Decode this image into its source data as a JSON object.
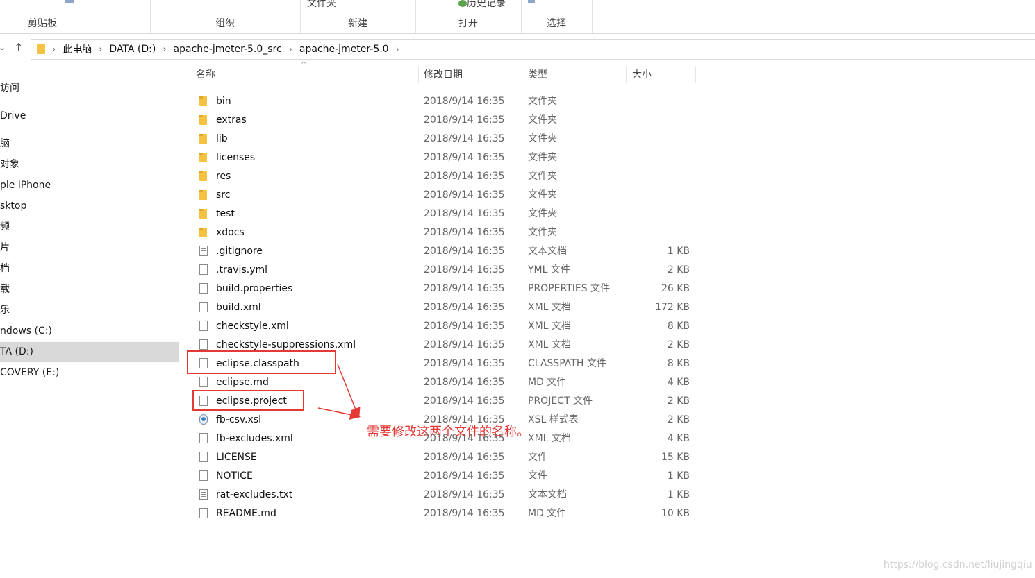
{
  "ribbon": {
    "groups": [
      "剪贴板",
      "组织",
      "新建",
      "打开",
      "选择"
    ],
    "top_new_folder": "文件夹",
    "top_history": "历史记录"
  },
  "address": {
    "crumbs": [
      "此电脑",
      "DATA (D:)",
      "apache-jmeter-5.0_src",
      "apache-jmeter-5.0"
    ]
  },
  "nav": {
    "items": [
      "访问",
      "Drive",
      "脑",
      "对象",
      "ple iPhone",
      "sktop",
      "频",
      "片",
      "档",
      "载",
      "乐",
      "ndows (C:)",
      "TA (D:)",
      "COVERY (E:)"
    ]
  },
  "columns": {
    "name": "名称",
    "date": "修改日期",
    "type": "类型",
    "size": "大小"
  },
  "files": [
    {
      "name": "bin",
      "date": "2018/9/14 16:35",
      "type": "文件夹",
      "size": "",
      "icon": "folder-icon"
    },
    {
      "name": "extras",
      "date": "2018/9/14 16:35",
      "type": "文件夹",
      "size": "",
      "icon": "folder-icon"
    },
    {
      "name": "lib",
      "date": "2018/9/14 16:35",
      "type": "文件夹",
      "size": "",
      "icon": "folder-icon"
    },
    {
      "name": "licenses",
      "date": "2018/9/14 16:35",
      "type": "文件夹",
      "size": "",
      "icon": "folder-icon"
    },
    {
      "name": "res",
      "date": "2018/9/14 16:35",
      "type": "文件夹",
      "size": "",
      "icon": "folder-icon"
    },
    {
      "name": "src",
      "date": "2018/9/14 16:35",
      "type": "文件夹",
      "size": "",
      "icon": "folder-icon"
    },
    {
      "name": "test",
      "date": "2018/9/14 16:35",
      "type": "文件夹",
      "size": "",
      "icon": "folder-icon"
    },
    {
      "name": "xdocs",
      "date": "2018/9/14 16:35",
      "type": "文件夹",
      "size": "",
      "icon": "folder-icon"
    },
    {
      "name": ".gitignore",
      "date": "2018/9/14 16:35",
      "type": "文本文档",
      "size": "1 KB",
      "icon": "text-file-icon"
    },
    {
      "name": ".travis.yml",
      "date": "2018/9/14 16:35",
      "type": "YML 文件",
      "size": "2 KB",
      "icon": "file-icon"
    },
    {
      "name": "build.properties",
      "date": "2018/9/14 16:35",
      "type": "PROPERTIES 文件",
      "size": "26 KB",
      "icon": "file-icon"
    },
    {
      "name": "build.xml",
      "date": "2018/9/14 16:35",
      "type": "XML 文档",
      "size": "172 KB",
      "icon": "file-icon"
    },
    {
      "name": "checkstyle.xml",
      "date": "2018/9/14 16:35",
      "type": "XML 文档",
      "size": "8 KB",
      "icon": "file-icon"
    },
    {
      "name": "checkstyle-suppressions.xml",
      "date": "2018/9/14 16:35",
      "type": "XML 文档",
      "size": "2 KB",
      "icon": "file-icon"
    },
    {
      "name": "eclipse.classpath",
      "date": "2018/9/14 16:35",
      "type": "CLASSPATH 文件",
      "size": "8 KB",
      "icon": "file-icon"
    },
    {
      "name": "eclipse.md",
      "date": "2018/9/14 16:35",
      "type": "MD 文件",
      "size": "4 KB",
      "icon": "file-icon"
    },
    {
      "name": "eclipse.project",
      "date": "2018/9/14 16:35",
      "type": "PROJECT 文件",
      "size": "2 KB",
      "icon": "file-icon"
    },
    {
      "name": "fb-csv.xsl",
      "date": "2018/9/14 16:35",
      "type": "XSL 样式表",
      "size": "2 KB",
      "icon": "xsl-file-icon"
    },
    {
      "name": "fb-excludes.xml",
      "date": "2018/9/14 16:35",
      "type": "XML 文档",
      "size": "4 KB",
      "icon": "file-icon"
    },
    {
      "name": "LICENSE",
      "date": "2018/9/14 16:35",
      "type": "文件",
      "size": "15 KB",
      "icon": "file-icon"
    },
    {
      "name": "NOTICE",
      "date": "2018/9/14 16:35",
      "type": "文件",
      "size": "1 KB",
      "icon": "file-icon"
    },
    {
      "name": "rat-excludes.txt",
      "date": "2018/9/14 16:35",
      "type": "文本文档",
      "size": "1 KB",
      "icon": "text-file-icon"
    },
    {
      "name": "README.md",
      "date": "2018/9/14 16:35",
      "type": "MD 文件",
      "size": "10 KB",
      "icon": "file-icon"
    }
  ],
  "annotation": {
    "text": "需要修改这两个文件的名称。",
    "color": "#e53935"
  },
  "watermark": "https://blog.csdn.net/liujingqiu"
}
